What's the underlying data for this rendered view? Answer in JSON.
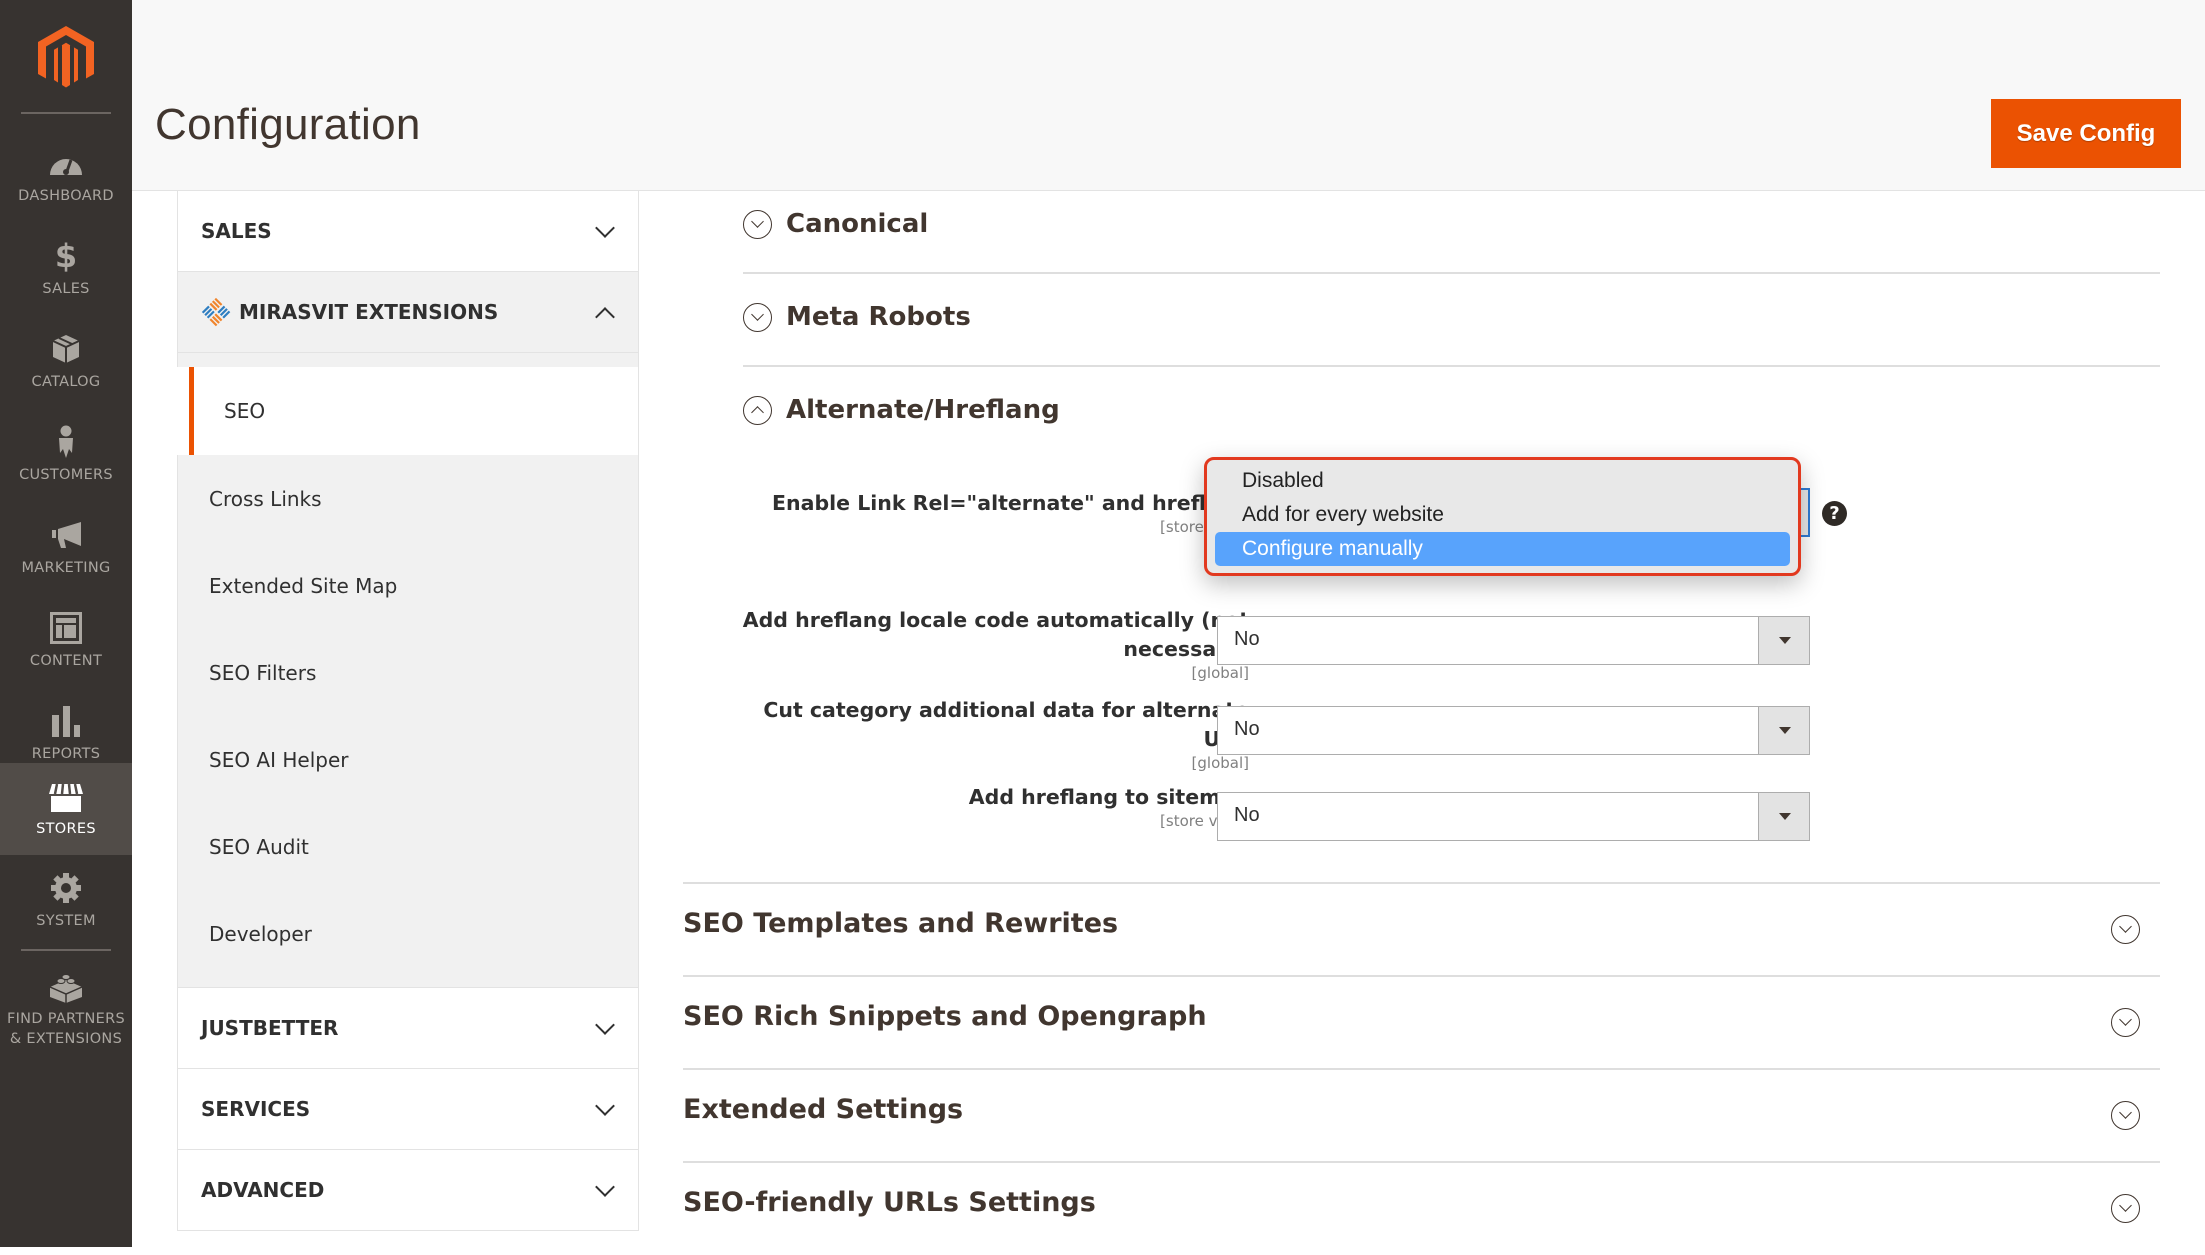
{
  "sidebar": {
    "items": [
      {
        "label": "DASHBOARD",
        "icon": "dashboard-icon"
      },
      {
        "label": "SALES",
        "icon": "dollar-icon"
      },
      {
        "label": "CATALOG",
        "icon": "box-icon"
      },
      {
        "label": "CUSTOMERS",
        "icon": "person-icon"
      },
      {
        "label": "MARKETING",
        "icon": "megaphone-icon"
      },
      {
        "label": "CONTENT",
        "icon": "layout-icon"
      },
      {
        "label": "REPORTS",
        "icon": "bar-chart-icon"
      },
      {
        "label": "STORES",
        "icon": "store-icon",
        "active": true
      },
      {
        "label": "SYSTEM",
        "icon": "gear-icon"
      },
      {
        "label": "FIND PARTNERS & EXTENSIONS",
        "label_line1": "FIND PARTNERS",
        "label_line2": "& EXTENSIONS",
        "icon": "lego-block-icon"
      }
    ]
  },
  "header": {
    "title": "Configuration",
    "save_label": "Save Config"
  },
  "colors": {
    "accent": "#eb5202",
    "sidebar_bg": "#373330",
    "dropdown_highlight": "#58a3fc",
    "dropdown_border": "#e2391f"
  },
  "config_nav": {
    "sales": "SALES",
    "mirasvit": "MIRASVIT EXTENSIONS",
    "active_item": "SEO",
    "sub_items": [
      "Cross Links",
      "Extended Site Map",
      "SEO Filters",
      "SEO AI Helper",
      "SEO Audit",
      "Developer"
    ],
    "justbetter": "JUSTBETTER",
    "services": "SERVICES",
    "advanced": "ADVANCED"
  },
  "main": {
    "groups": {
      "canonical": "Canonical",
      "meta_robots": "Meta Robots",
      "alternate": "Alternate/Hreflang"
    },
    "fields": [
      {
        "label": "Enable Link Rel=\"alternate\" and hreflang",
        "scope": "[store view]",
        "value": "Configure manually"
      },
      {
        "label_line1": "Add hreflang locale code automatically (not",
        "label_line2": "necessary)",
        "scope": "[global]",
        "value": "No"
      },
      {
        "label_line1": "Cut category additional data for alternate",
        "label_line2": "URL",
        "scope": "[global]",
        "value": "No"
      },
      {
        "label": "Add hreflang to sitemap",
        "scope": "[store view]",
        "value": "No"
      }
    ],
    "dropdown_options": [
      "Disabled",
      "Add for every website",
      "Configure manually"
    ],
    "dropdown_selected": "Configure manually",
    "help_glyph": "?",
    "sections": [
      "SEO Templates and Rewrites",
      "SEO Rich Snippets and Opengraph",
      "Extended Settings",
      "SEO-friendly URLs Settings"
    ]
  }
}
